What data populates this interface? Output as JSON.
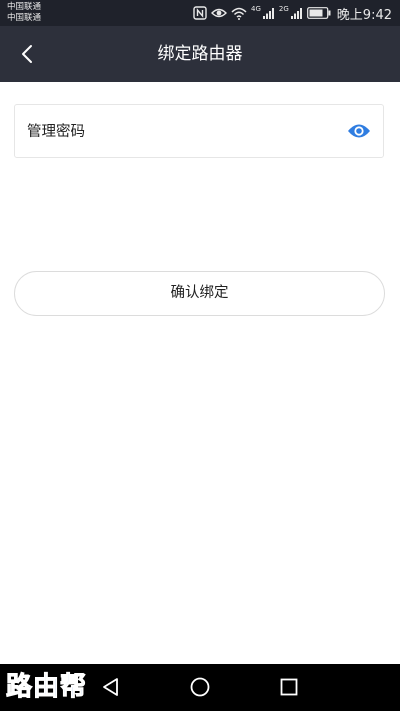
{
  "status_bar": {
    "carrier_1": "中国联通",
    "carrier_2": "中国联通",
    "signal_1_label": "4G",
    "signal_2_label": "2G",
    "time": "晚上9:42",
    "icons": [
      "nfc-icon",
      "eye-comfort-icon",
      "wifi-icon",
      "signal-icon",
      "signal-icon",
      "battery-icon"
    ]
  },
  "header": {
    "title": "绑定路由器",
    "back_icon": "chevron-left-icon"
  },
  "password": {
    "label": "管理密码",
    "value": "",
    "visibility_icon": "eye-icon",
    "accent_color": "#2f7de1"
  },
  "confirm_button": {
    "label": "确认绑定"
  },
  "nav_bar": {
    "icons": [
      "back-triangle-icon",
      "home-circle-icon",
      "recents-square-icon"
    ]
  },
  "watermark": {
    "text": "路由帮"
  }
}
